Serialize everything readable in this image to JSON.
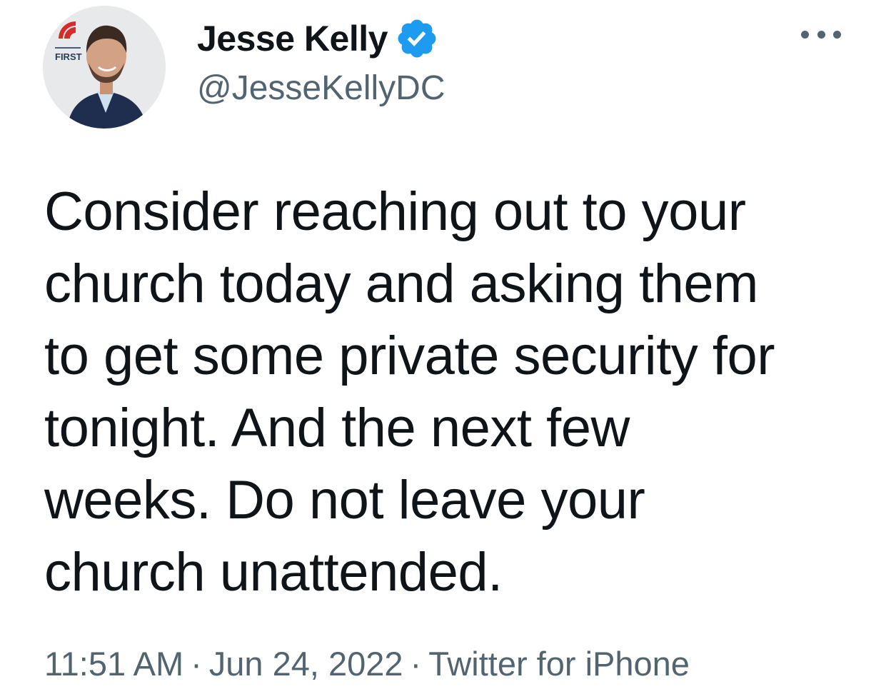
{
  "author": {
    "display_name": "Jesse Kelly",
    "handle": "@JesseKellyDC",
    "verified": true,
    "avatar_icon": "profile-photo",
    "avatar_logo_text": "FIRST"
  },
  "more_icon": "more-horizontal-icon",
  "tweet": {
    "text_lines": [
      "Consider reaching out to your",
      "church today and asking them",
      "to get some private security for",
      "tonight. And the next few",
      "weeks. Do not leave your",
      "church unattended."
    ]
  },
  "meta": {
    "time": "11:51 AM",
    "separator": "·",
    "date": "Jun 24, 2022",
    "source": "Twitter for iPhone"
  },
  "colors": {
    "verified_blue": "#1d9bf0",
    "secondary_text": "#536471",
    "primary_text": "#0f1419"
  }
}
